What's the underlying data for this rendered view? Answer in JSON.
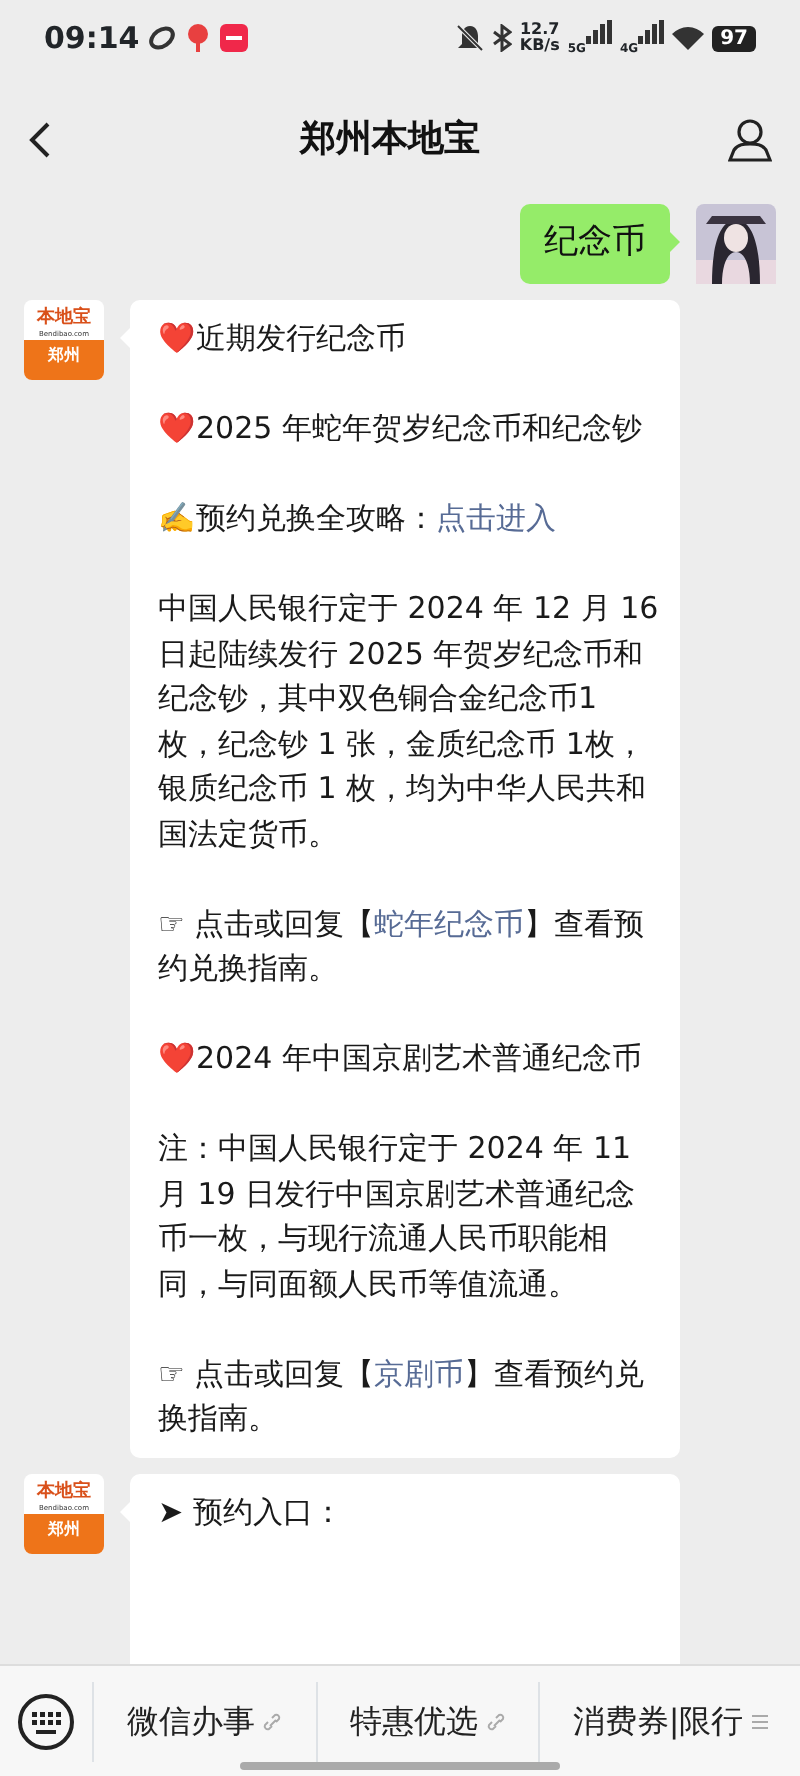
{
  "status_bar": {
    "time": "09:14",
    "net_speed": "12.7",
    "net_unit": "KB/s",
    "sim1": "5G",
    "sim2": "4G",
    "battery": "97"
  },
  "header": {
    "title": "郑州本地宝"
  },
  "messages": [
    {
      "kind": "outgoing",
      "text": "纪念币"
    },
    {
      "kind": "incoming",
      "logo": {
        "name": "本地宝",
        "site": "Bendibao.com",
        "city": "郑州"
      },
      "paragraphs": [
        [
          {
            "kind": "text",
            "text": "❤️近期发行纪念币"
          }
        ],
        [
          {
            "kind": "text",
            "text": "❤️2025 年蛇年贺岁纪念币和纪念钞"
          }
        ],
        [
          {
            "kind": "text",
            "text": "✍️预约兑换全攻略："
          },
          {
            "kind": "link",
            "text": "点击进入"
          }
        ],
        [
          {
            "kind": "text",
            "text": "中国人民银行定于 2024 年 12 月 16日起陆续发行 2025 年贺岁纪念币和纪念钞，其中双色铜合金纪念币1 枚，纪念钞 1 张，金质纪念币 1枚，银质纪念币 1 枚，均为中华人民共和国法定货币。"
          }
        ],
        [
          {
            "kind": "text",
            "text": "☞ 点击或回复【"
          },
          {
            "kind": "link",
            "text": "蛇年纪念币"
          },
          {
            "kind": "text",
            "text": "】查看预约兑换指南。"
          }
        ],
        [
          {
            "kind": "text",
            "text": "❤️2024 年中国京剧艺术普通纪念币"
          }
        ],
        [
          {
            "kind": "text",
            "text": "注：中国人民银行定于 2024 年 11 月 19 日发行中国京剧艺术普通纪念币一枚，与现行流通人民币职能相同，与同面额人民币等值流通。"
          }
        ],
        [
          {
            "kind": "text",
            "text": "☞ 点击或回复【"
          },
          {
            "kind": "link",
            "text": "京剧币"
          },
          {
            "kind": "text",
            "text": "】查看预约兑换指南。"
          }
        ]
      ]
    },
    {
      "kind": "incoming",
      "logo": {
        "name": "本地宝",
        "site": "Bendibao.com",
        "city": "郑州"
      },
      "paragraphs": [
        [
          {
            "kind": "text",
            "text": "➤ 预约入口："
          }
        ]
      ]
    }
  ],
  "bottom_menu": [
    {
      "label": "微信办事",
      "kind": "link"
    },
    {
      "label": "特惠优选",
      "kind": "link"
    },
    {
      "label": "消费券|限行",
      "kind": "submenu"
    }
  ]
}
